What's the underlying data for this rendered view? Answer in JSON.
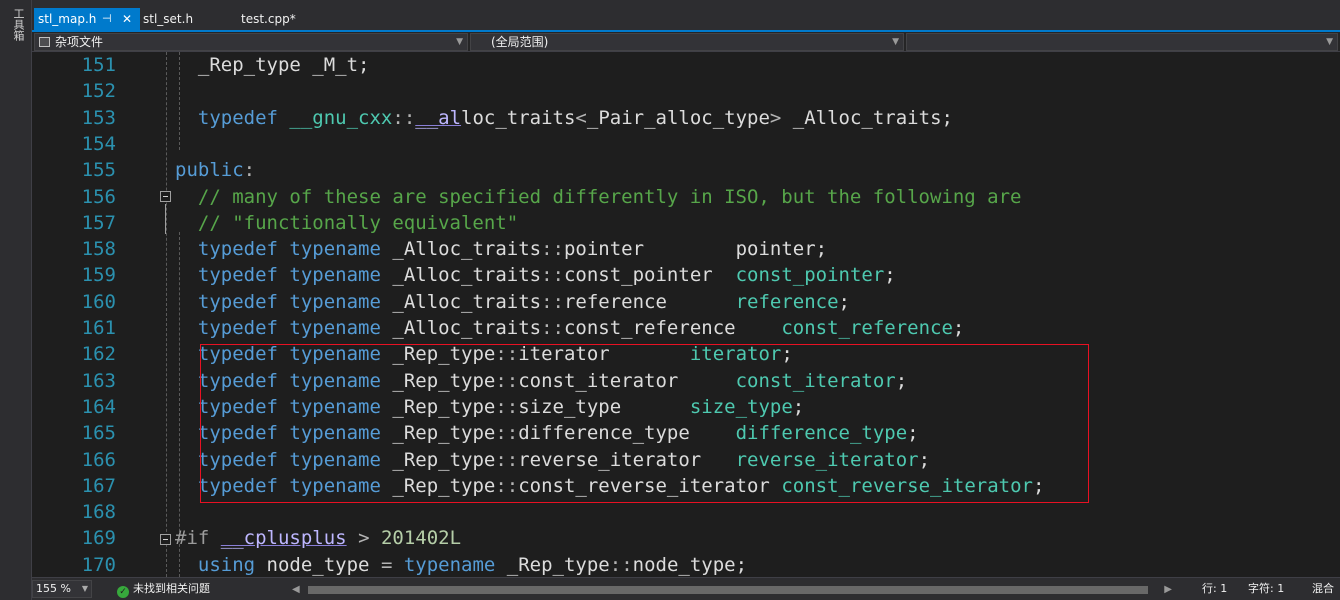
{
  "toolstrip": {
    "label": "工具箱"
  },
  "tabs": [
    {
      "label": "stl_map.h",
      "active": true,
      "pin": "⊣",
      "close": "✕"
    },
    {
      "label": "stl_set.h",
      "active": false
    },
    {
      "label": "test.cpp*",
      "active": false
    }
  ],
  "nav": {
    "project": "杂项文件",
    "scope": "(全局范围)",
    "member": ""
  },
  "colors": {
    "keyword": "#569cd6",
    "type": "#4ec9b0",
    "comment": "#57a64a",
    "number": "#b5cea8",
    "preprocessor": "#9b9b9b",
    "macro": "#beb7ff",
    "identifier": "#dcdcdc",
    "operator": "#b4b4b4",
    "line_number": "#2b91af",
    "highlight_border": "#e81123"
  },
  "lines": [
    {
      "number": "151",
      "tokens": [
        [
          "  ",
          "id"
        ],
        [
          "_Rep_type _M_t;",
          "id"
        ]
      ]
    },
    {
      "number": "152",
      "tokens": []
    },
    {
      "number": "153",
      "tokens": [
        [
          "  ",
          "id"
        ],
        [
          "typedef",
          "kw"
        ],
        [
          " ",
          "id"
        ],
        [
          "__gnu_cxx",
          "ns"
        ],
        [
          "::",
          "op"
        ],
        [
          "__al",
          "macro"
        ],
        [
          "loc_traits",
          "id"
        ],
        [
          "<",
          "op"
        ],
        [
          "_Pair_alloc_type",
          "id"
        ],
        [
          "> ",
          "op"
        ],
        [
          "_Alloc_traits;",
          "id"
        ]
      ]
    },
    {
      "number": "154",
      "tokens": []
    },
    {
      "number": "155",
      "tokens": [
        [
          "public",
          "kw"
        ],
        [
          ":",
          "op"
        ]
      ]
    },
    {
      "number": "156",
      "tokens": [
        [
          "  ",
          "id"
        ],
        [
          "// many of these are specified differently in ISO, but the following are",
          "cm"
        ]
      ]
    },
    {
      "number": "157",
      "tokens": [
        [
          "  ",
          "id"
        ],
        [
          "// \"functionally equivalent\"",
          "cm"
        ]
      ]
    },
    {
      "number": "158",
      "tokens": [
        [
          "  ",
          "id"
        ],
        [
          "typedef",
          "kw"
        ],
        [
          " ",
          "id"
        ],
        [
          "typename",
          "kw"
        ],
        [
          " _Alloc_traits",
          "id"
        ],
        [
          "::",
          "op"
        ],
        [
          "pointer        pointer;",
          "id"
        ]
      ]
    },
    {
      "number": "159",
      "tokens": [
        [
          "  ",
          "id"
        ],
        [
          "typedef",
          "kw"
        ],
        [
          " ",
          "id"
        ],
        [
          "typename",
          "kw"
        ],
        [
          " _Alloc_traits",
          "id"
        ],
        [
          "::",
          "op"
        ],
        [
          "const_pointer  ",
          "id"
        ],
        [
          "const_pointer",
          "ty"
        ],
        [
          ";",
          "id"
        ]
      ]
    },
    {
      "number": "160",
      "tokens": [
        [
          "  ",
          "id"
        ],
        [
          "typedef",
          "kw"
        ],
        [
          " ",
          "id"
        ],
        [
          "typename",
          "kw"
        ],
        [
          " _Alloc_traits",
          "id"
        ],
        [
          "::",
          "op"
        ],
        [
          "reference      ",
          "id"
        ],
        [
          "reference",
          "ty"
        ],
        [
          ";",
          "id"
        ]
      ]
    },
    {
      "number": "161",
      "tokens": [
        [
          "  ",
          "id"
        ],
        [
          "typedef",
          "kw"
        ],
        [
          " ",
          "id"
        ],
        [
          "typename",
          "kw"
        ],
        [
          " _Alloc_traits",
          "id"
        ],
        [
          "::",
          "op"
        ],
        [
          "const_reference    ",
          "id"
        ],
        [
          "const_reference",
          "ty"
        ],
        [
          ";",
          "id"
        ]
      ]
    },
    {
      "number": "162",
      "tokens": [
        [
          "  ",
          "id"
        ],
        [
          "typedef",
          "kw"
        ],
        [
          " ",
          "id"
        ],
        [
          "typename",
          "kw"
        ],
        [
          " _Rep_type",
          "id"
        ],
        [
          "::",
          "op"
        ],
        [
          "iterator       ",
          "id"
        ],
        [
          "iterator",
          "ty"
        ],
        [
          ";",
          "id"
        ]
      ]
    },
    {
      "number": "163",
      "tokens": [
        [
          "  ",
          "id"
        ],
        [
          "typedef",
          "kw"
        ],
        [
          " ",
          "id"
        ],
        [
          "typename",
          "kw"
        ],
        [
          " _Rep_type",
          "id"
        ],
        [
          "::",
          "op"
        ],
        [
          "const_iterator     ",
          "id"
        ],
        [
          "const_iterator",
          "ty"
        ],
        [
          ";",
          "id"
        ]
      ]
    },
    {
      "number": "164",
      "tokens": [
        [
          "  ",
          "id"
        ],
        [
          "typedef",
          "kw"
        ],
        [
          " ",
          "id"
        ],
        [
          "typename",
          "kw"
        ],
        [
          " _Rep_type",
          "id"
        ],
        [
          "::",
          "op"
        ],
        [
          "size_type      ",
          "id"
        ],
        [
          "size_type",
          "ty"
        ],
        [
          ";",
          "id"
        ]
      ]
    },
    {
      "number": "165",
      "tokens": [
        [
          "  ",
          "id"
        ],
        [
          "typedef",
          "kw"
        ],
        [
          " ",
          "id"
        ],
        [
          "typename",
          "kw"
        ],
        [
          " _Rep_type",
          "id"
        ],
        [
          "::",
          "op"
        ],
        [
          "difference_type    ",
          "id"
        ],
        [
          "difference_type",
          "ty"
        ],
        [
          ";",
          "id"
        ]
      ]
    },
    {
      "number": "166",
      "tokens": [
        [
          "  ",
          "id"
        ],
        [
          "typedef",
          "kw"
        ],
        [
          " ",
          "id"
        ],
        [
          "typename",
          "kw"
        ],
        [
          " _Rep_type",
          "id"
        ],
        [
          "::",
          "op"
        ],
        [
          "reverse_iterator   ",
          "id"
        ],
        [
          "reverse_iterator",
          "ty"
        ],
        [
          ";",
          "id"
        ]
      ]
    },
    {
      "number": "167",
      "tokens": [
        [
          "  ",
          "id"
        ],
        [
          "typedef",
          "kw"
        ],
        [
          " ",
          "id"
        ],
        [
          "typename",
          "kw"
        ],
        [
          " _Rep_type",
          "id"
        ],
        [
          "::",
          "op"
        ],
        [
          "const_reverse_iterator ",
          "id"
        ],
        [
          "const_reverse_iterator",
          "ty"
        ],
        [
          ";",
          "id"
        ]
      ]
    },
    {
      "number": "168",
      "tokens": []
    },
    {
      "number": "169",
      "tokens": [
        [
          "#if",
          "pp"
        ],
        [
          " ",
          "id"
        ],
        [
          "__cplusplus",
          "macro"
        ],
        [
          " > ",
          "op"
        ],
        [
          "201402L",
          "num"
        ]
      ]
    },
    {
      "number": "170",
      "tokens": [
        [
          "  ",
          "id"
        ],
        [
          "using",
          "kw"
        ],
        [
          " node_type ",
          "id"
        ],
        [
          "=",
          "op"
        ],
        [
          " ",
          "id"
        ],
        [
          "typename",
          "kw"
        ],
        [
          " _Rep_type",
          "id"
        ],
        [
          "::",
          "op"
        ],
        [
          "node_type;",
          "id"
        ]
      ]
    }
  ],
  "status": {
    "zoom": "155 %",
    "issues": "未找到相关问题",
    "row": "行: 1",
    "col": "字符: 1",
    "mode": "混合"
  }
}
